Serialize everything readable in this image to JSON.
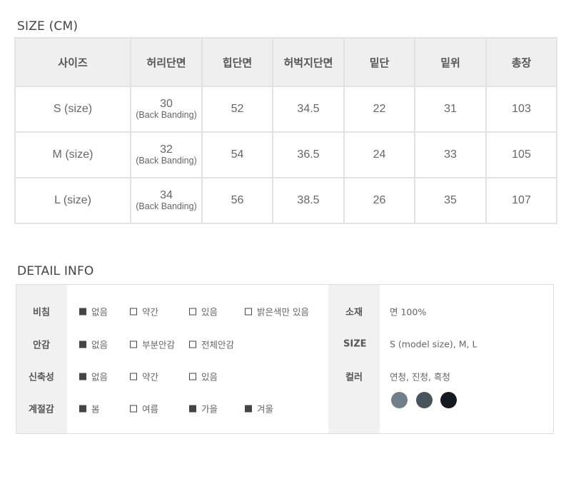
{
  "size_section": {
    "title": "SIZE (CM)",
    "headers": [
      "사이즈",
      "허리단면",
      "힙단면",
      "허벅지단면",
      "밑단",
      "밑위",
      "총장"
    ],
    "rows": [
      {
        "size": "S (size)",
        "waist": "30",
        "waist_note": "(Back Banding)",
        "hip": "52",
        "thigh": "34.5",
        "hem": "22",
        "rise": "31",
        "length": "103"
      },
      {
        "size": "M (size)",
        "waist": "32",
        "waist_note": "(Back Banding)",
        "hip": "54",
        "thigh": "36.5",
        "hem": "24",
        "rise": "33",
        "length": "105"
      },
      {
        "size": "L (size)",
        "waist": "34",
        "waist_note": "(Back Banding)",
        "hip": "56",
        "thigh": "38.5",
        "hem": "26",
        "rise": "35",
        "length": "107"
      }
    ]
  },
  "detail_section": {
    "title": "DETAIL INFO",
    "attributes": [
      {
        "label": "비침",
        "options": [
          {
            "text": "없음",
            "checked": true
          },
          {
            "text": "약간",
            "checked": false
          },
          {
            "text": "있음",
            "checked": false
          },
          {
            "text": "밝은색만 있음",
            "checked": false
          }
        ]
      },
      {
        "label": "안감",
        "options": [
          {
            "text": "없음",
            "checked": true
          },
          {
            "text": "부분안감",
            "checked": false
          },
          {
            "text": "전체안감",
            "checked": false
          }
        ]
      },
      {
        "label": "신축성",
        "options": [
          {
            "text": "없음",
            "checked": true
          },
          {
            "text": "약간",
            "checked": false
          },
          {
            "text": "있음",
            "checked": false
          }
        ]
      },
      {
        "label": "계절감",
        "options": [
          {
            "text": "봄",
            "checked": true
          },
          {
            "text": "여름",
            "checked": false
          },
          {
            "text": "가을",
            "checked": true
          },
          {
            "text": "겨울",
            "checked": true
          }
        ]
      }
    ],
    "material": {
      "label": "소재",
      "value": "면 100%"
    },
    "size_info": {
      "label": "SIZE",
      "value": "S (model size), M, L"
    },
    "color": {
      "label": "컬러",
      "value": "연청, 진청, 흑청",
      "swatches": [
        "#717f8a",
        "#48545c",
        "#151a22"
      ]
    }
  }
}
